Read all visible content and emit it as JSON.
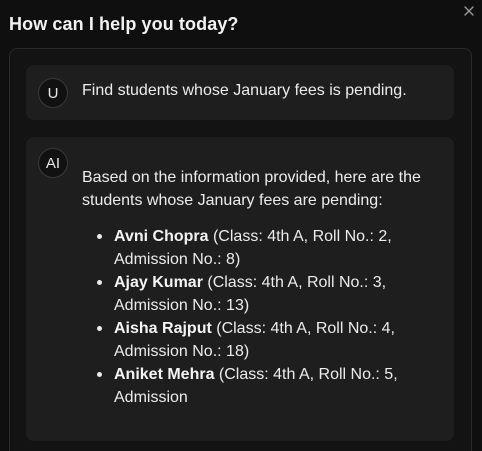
{
  "dialog": {
    "title": "How can I help you today?",
    "close_icon": "close-icon"
  },
  "messages": {
    "user": {
      "avatar": "U",
      "text": "Find students whose January fees is pending."
    },
    "ai": {
      "avatar": "AI",
      "intro": "Based on the information provided, here are the students whose January fees are pending:",
      "students": [
        {
          "name": "Avni Chopra",
          "details": " (Class: 4th A, Roll No.: 2, Admission No.: 8)"
        },
        {
          "name": "Ajay Kumar",
          "details": " (Class: 4th A, Roll No.: 3, Admission No.: 13)"
        },
        {
          "name": "Aisha Rajput",
          "details": " (Class: 4th A, Roll No.: 4, Admission No.: 18)"
        },
        {
          "name": "Aniket Mehra",
          "details": " (Class: 4th A, Roll No.: 5, Admission"
        }
      ]
    }
  }
}
